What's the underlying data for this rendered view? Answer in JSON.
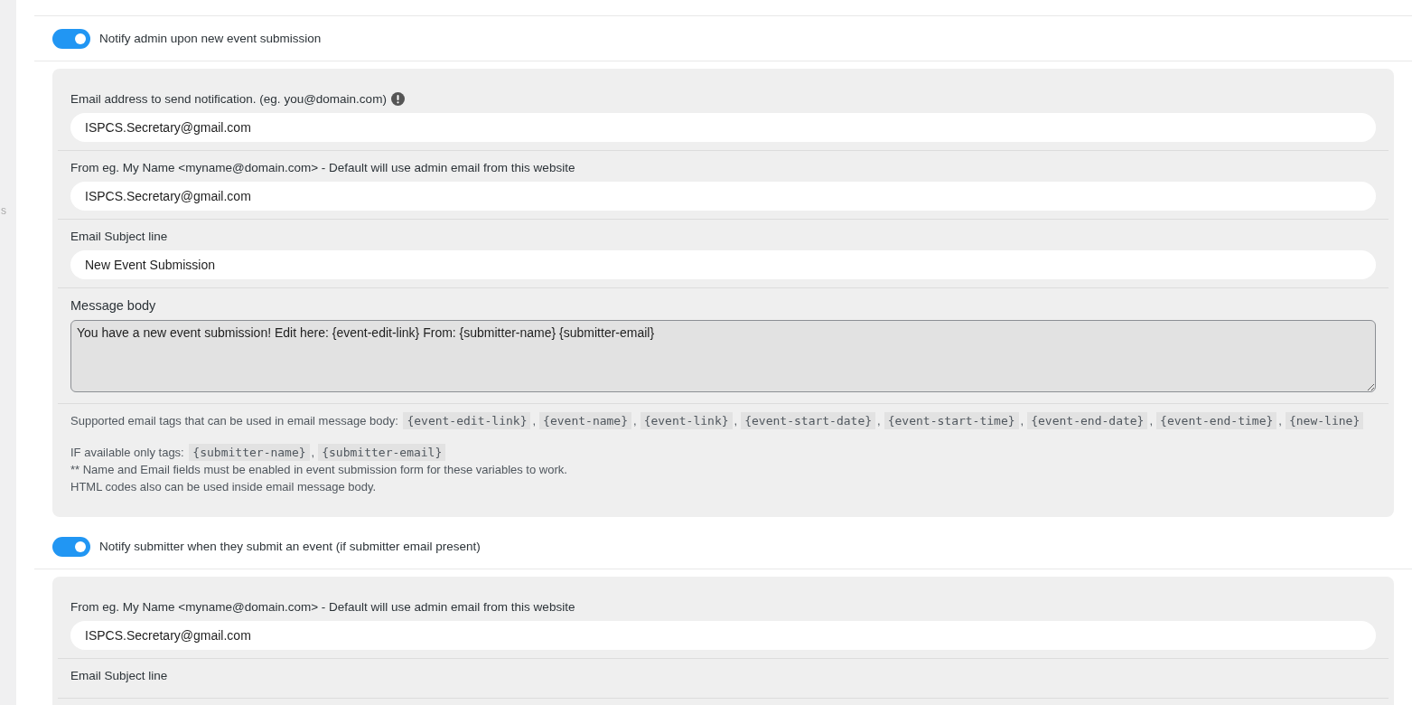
{
  "sidebar": {
    "fragment": "s"
  },
  "sections": [
    {
      "toggle": {
        "label": "Notify admin upon new event submission",
        "on": true
      },
      "fields": [
        {
          "kind": "input",
          "label": "Email address to send notification. (eg. you@domain.com)",
          "info_icon": true,
          "value": "ISPCS.Secretary@gmail.com"
        },
        {
          "kind": "input",
          "label": "From eg. My Name <myname@domain.com> - Default will use admin email from this website",
          "value": "ISPCS.Secretary@gmail.com"
        },
        {
          "kind": "input",
          "label": "Email Subject line",
          "value": "New Event Submission"
        },
        {
          "kind": "textarea",
          "label": "Message body",
          "value": "You have a new event submission! Edit here: {event-edit-link} From: {submitter-name} {submitter-email}"
        }
      ],
      "help": {
        "tags_intro": "Supported email tags that can be used in email message body:",
        "separator": ",",
        "tags": [
          "{event-edit-link}",
          "{event-name}",
          "{event-link}",
          "{event-start-date}",
          "{event-start-time}",
          "{event-end-date}",
          "{event-end-time}",
          "{new-line}"
        ],
        "available_intro": "IF available only tags:",
        "available_tags": [
          "{submitter-name}",
          "{submitter-email}"
        ],
        "notes": [
          "** Name and Email fields must be enabled in event submission form for these variables to work.",
          "HTML codes also can be used inside email message body."
        ]
      }
    },
    {
      "toggle": {
        "label": "Notify submitter when they submit an event (if submitter email present)",
        "on": true
      },
      "fields": [
        {
          "kind": "input",
          "label": "From eg. My Name <myname@domain.com> - Default will use admin email from this website",
          "value": "ISPCS.Secretary@gmail.com"
        },
        {
          "kind": "input",
          "label": "Email Subject line"
        }
      ]
    }
  ]
}
